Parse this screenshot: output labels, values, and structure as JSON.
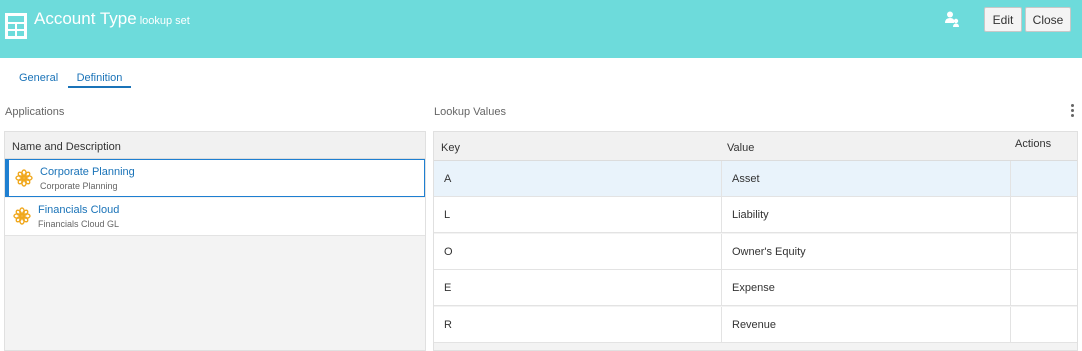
{
  "header": {
    "title": "Account Type",
    "subtitle": "lookup set",
    "app_icon": "grid-app-icon",
    "admin_icon": "users-admin-icon",
    "edit_label": "Edit",
    "close_label": "Close",
    "accent_color": "#6ddbdb"
  },
  "tabs": [
    {
      "label": "General",
      "active": false
    },
    {
      "label": "Definition",
      "active": true
    }
  ],
  "applications": {
    "section_label": "Applications",
    "column_header": "Name and Description",
    "items": [
      {
        "name": "Corporate Planning",
        "description": "Corporate Planning",
        "icon": "flower-app-icon",
        "selected": true
      },
      {
        "name": "Financials Cloud",
        "description": "Financials Cloud GL",
        "icon": "flower-app-icon",
        "selected": false
      }
    ]
  },
  "lookup": {
    "section_label": "Lookup Values",
    "menu_icon": "kebab-menu-icon",
    "columns": {
      "key": "Key",
      "value": "Value",
      "actions": "Actions"
    },
    "rows": [
      {
        "key": "A",
        "value": "Asset",
        "highlighted": true
      },
      {
        "key": "L",
        "value": "Liability",
        "highlighted": false
      },
      {
        "key": "O",
        "value": "Owner's Equity",
        "highlighted": false
      },
      {
        "key": "E",
        "value": "Expense",
        "highlighted": false
      },
      {
        "key": "R",
        "value": "Revenue",
        "highlighted": false
      }
    ]
  }
}
